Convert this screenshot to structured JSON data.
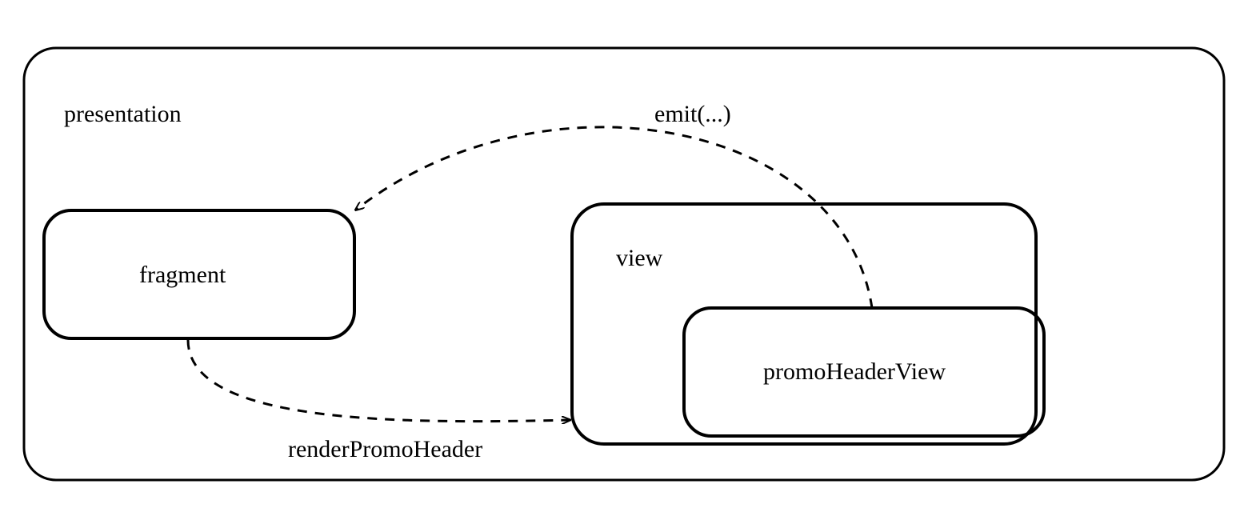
{
  "container": {
    "label": "presentation"
  },
  "nodes": {
    "fragment": {
      "label": "fragment"
    },
    "view": {
      "label": "view"
    },
    "promoHeaderView": {
      "label": "promoHeaderView"
    }
  },
  "edges": {
    "emit": {
      "label": "emit(...)"
    },
    "renderPromoHeader": {
      "label": "renderPromoHeader"
    }
  }
}
